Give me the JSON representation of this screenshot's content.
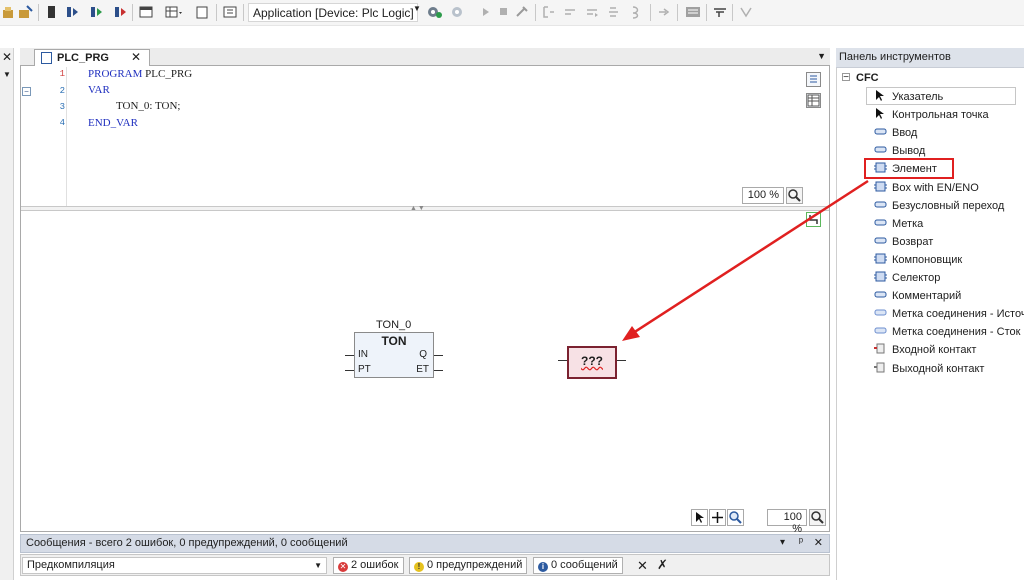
{
  "toolbar": {
    "application_combo": "Application [Device: Plc Logic]"
  },
  "editor": {
    "tab_label": "PLC_PRG",
    "declaration": {
      "line_numbers": [
        "1",
        "2",
        "3",
        "4"
      ],
      "line1_kw": "PROGRAM",
      "line1_rest": " PLC_PRG",
      "line2_kw": "VAR",
      "line3_text": "TON_0: TON;",
      "line4_kw": "END_VAR"
    },
    "decl_zoom": "100 %",
    "cfc_zoom": "100 %"
  },
  "cfc": {
    "ton_instance": "TON_0",
    "ton_type": "TON",
    "ton_pins": {
      "in": "IN",
      "pt": "PT",
      "q": "Q",
      "et": "ET"
    },
    "placeholder_label": "???"
  },
  "messages": {
    "header": "Сообщения - всего 2 ошибок, 0 предупреждений, 0 сообщений",
    "header_buttons": [
      "▾",
      "ᵖ",
      "✕"
    ],
    "source_selected": "Предкомпиляция",
    "errors": "2 ошибок",
    "warnings": "0 предупреждений",
    "infos": "0 сообщений"
  },
  "toolbox": {
    "title": "Панель инструментов",
    "category": "CFC",
    "items": [
      {
        "label": "Указатель",
        "icon": "pointer-icon"
      },
      {
        "label": "Контрольная точка",
        "icon": "control-point-icon"
      },
      {
        "label": "Ввод",
        "icon": "input-icon"
      },
      {
        "label": "Вывод",
        "icon": "output-icon"
      },
      {
        "label": "Элемент",
        "icon": "box-icon"
      },
      {
        "label": "Box with EN/ENO",
        "icon": "box-en-icon"
      },
      {
        "label": "Безусловный переход",
        "icon": "jump-icon"
      },
      {
        "label": "Метка",
        "icon": "label-icon"
      },
      {
        "label": "Возврат",
        "icon": "return-icon"
      },
      {
        "label": "Компоновщик",
        "icon": "composer-icon"
      },
      {
        "label": "Селектор",
        "icon": "selector-icon"
      },
      {
        "label": "Комментарий",
        "icon": "comment-icon"
      },
      {
        "label": "Метка соединения - Источник",
        "icon": "connection-mark-source-icon"
      },
      {
        "label": "Метка соединения - Сток",
        "icon": "connection-mark-sink-icon"
      },
      {
        "label": "Входной контакт",
        "icon": "input-pin-icon"
      },
      {
        "label": "Выходной контакт",
        "icon": "output-pin-icon"
      }
    ]
  },
  "colors": {
    "highlight": "#e02020",
    "arrow": "#e02020",
    "placeholder_fill": "#f7e1e5",
    "placeholder_border": "#7b2230",
    "keyword": "#1f2fbf"
  }
}
